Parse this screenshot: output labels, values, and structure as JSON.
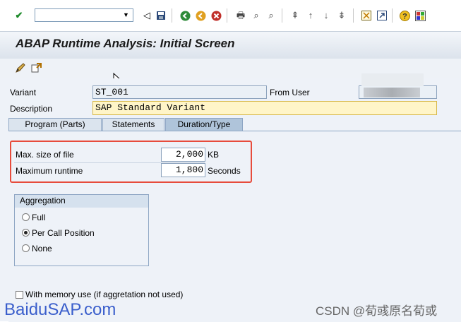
{
  "toolbar": {
    "command_field_value": "",
    "icons": [
      "enter-check-icon",
      "back-icon",
      "save-icon",
      "green-back-icon",
      "exit-icon",
      "cancel-icon",
      "print-icon",
      "find-icon",
      "find-next-icon",
      "first-page-icon",
      "previous-page-icon",
      "next-page-icon",
      "last-page-icon",
      "create-session-icon",
      "shortcut-icon",
      "help-icon",
      "customize-layout-icon"
    ]
  },
  "title": "ABAP Runtime Analysis: Initial Screen",
  "app_toolbar": {
    "icons": [
      "edit-variant-icon",
      "display-variant-icon"
    ]
  },
  "form": {
    "variant_label": "Variant",
    "variant_value": "ST_001",
    "from_user_label": "From User",
    "from_user_value": "",
    "description_label": "Description",
    "description_value": "SAP Standard Variant"
  },
  "tabs": [
    {
      "label": "Program (Parts)",
      "active": false
    },
    {
      "label": "Statements",
      "active": false
    },
    {
      "label": "Duration/Type",
      "active": true
    }
  ],
  "duration": {
    "max_file_label": "Max. size of file",
    "max_file_value": "2,000",
    "max_file_unit": "KB",
    "max_runtime_label": "Maximum runtime",
    "max_runtime_value": "1,800",
    "max_runtime_unit": "Seconds"
  },
  "aggregation": {
    "title": "Aggregation",
    "options": [
      {
        "label": "Full",
        "selected": false
      },
      {
        "label": "Per Call Position",
        "selected": true
      },
      {
        "label": "None",
        "selected": false
      }
    ]
  },
  "memory_use": {
    "label": "With memory use (if aggretation not used)",
    "checked": false
  },
  "watermarks": {
    "left": "BaiduSAP.com",
    "right": "CSDN @荀彧原名荀或"
  },
  "colors": {
    "highlight": "#e74c3c",
    "description_bg": "#fff5c8"
  }
}
